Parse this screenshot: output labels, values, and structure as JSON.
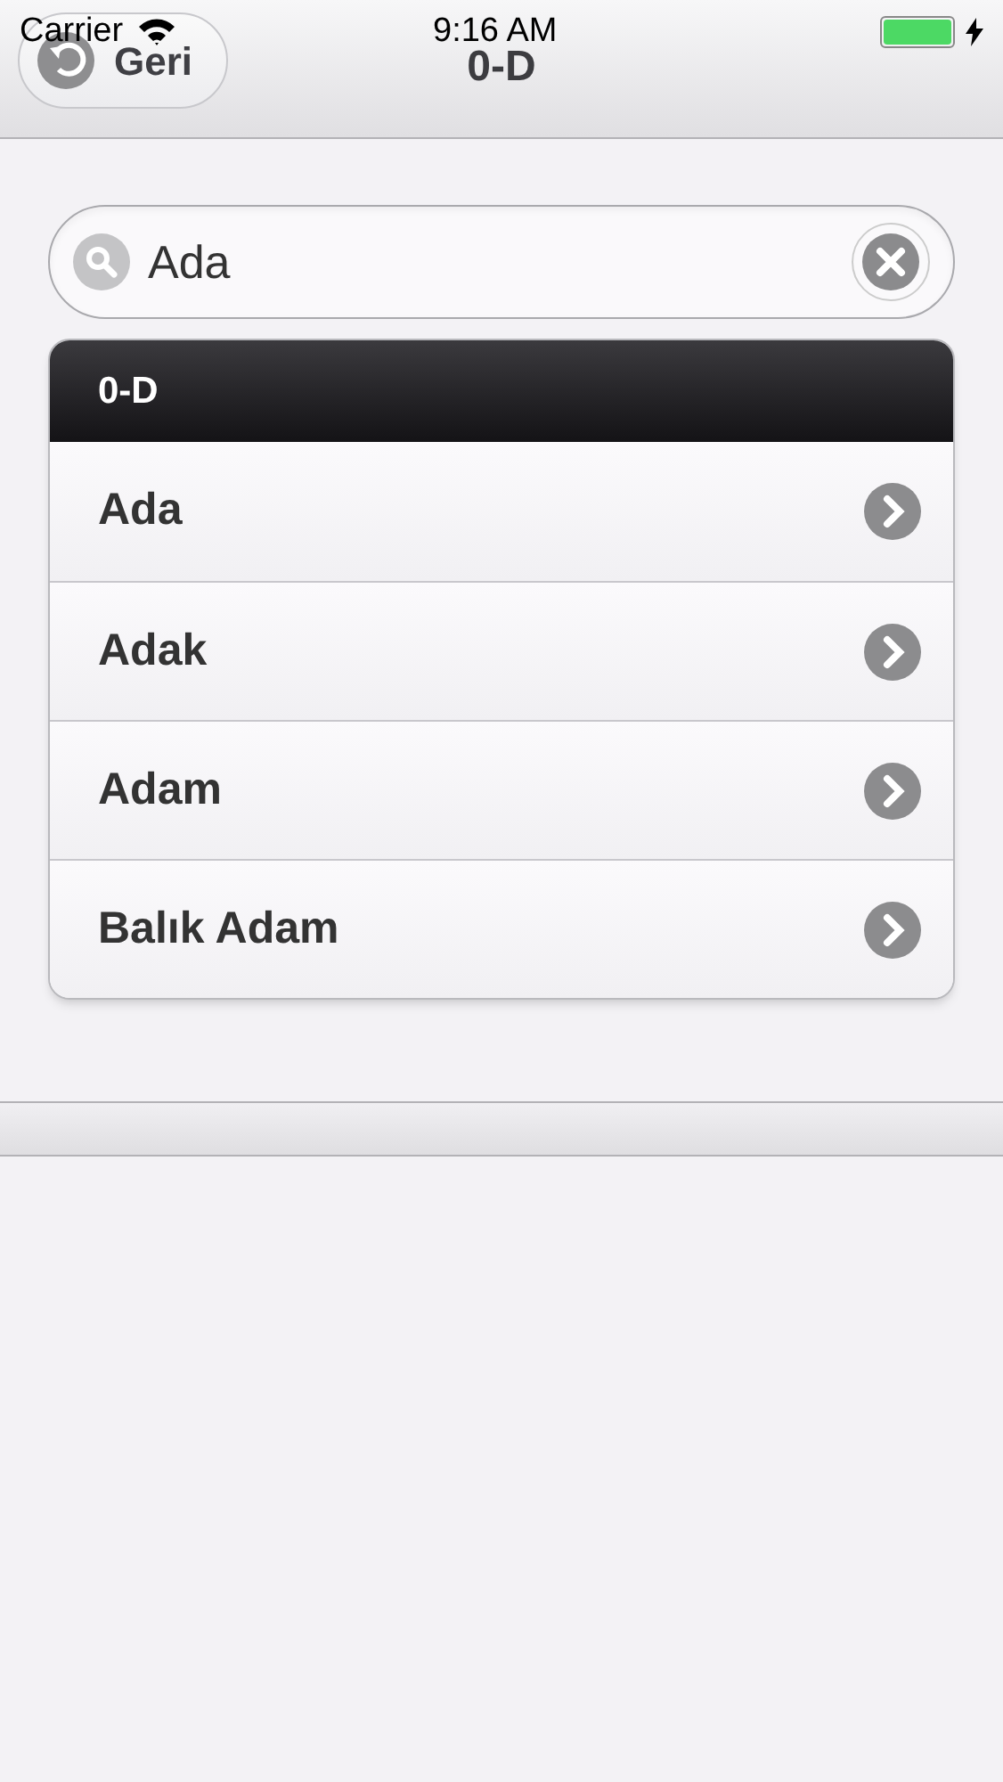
{
  "status_bar": {
    "carrier": "Carrier",
    "time": "9:16 AM",
    "battery": {
      "level": 1
    }
  },
  "nav": {
    "back": "Geri",
    "title": "0-D"
  },
  "search": {
    "value": "Ada"
  },
  "list": {
    "header": "0-D",
    "items": [
      {
        "label": "Ada"
      },
      {
        "label": "Adak"
      },
      {
        "label": "Adam"
      },
      {
        "label": "Balık Adam"
      }
    ]
  }
}
